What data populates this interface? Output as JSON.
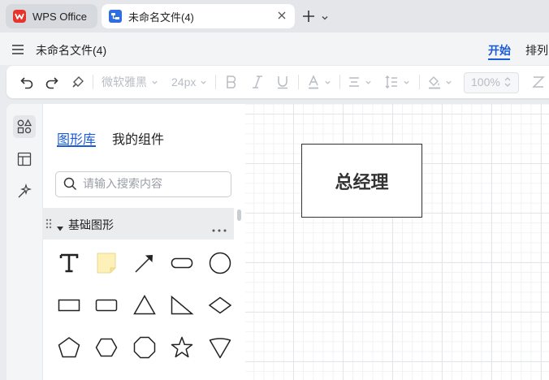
{
  "titlebar": {
    "tabs": [
      {
        "label": "WPS Office",
        "icon": "wps-logo-icon",
        "active": false
      },
      {
        "label": "未命名文件(4)",
        "icon": "diagram-file-icon",
        "active": true
      }
    ],
    "new_tab_icon": "plus-icon"
  },
  "menu": {
    "doc_title": "未命名文件(4)",
    "tabs": [
      {
        "label": "开始",
        "active": true
      },
      {
        "label": "排列",
        "active": false
      }
    ]
  },
  "toolbar": {
    "font_family": "微软雅黑",
    "font_size": "24px",
    "zoom": "100%"
  },
  "library": {
    "tab_shapes": "图形库",
    "tab_components": "我的组件",
    "search_placeholder": "请输入搜索内容",
    "category": "基础图形"
  },
  "canvas": {
    "node_label": "总经理"
  },
  "colors": {
    "accent": "#1b5bd7",
    "wps_red": "#e8352b",
    "sticky_note": "#fdf0b8"
  }
}
